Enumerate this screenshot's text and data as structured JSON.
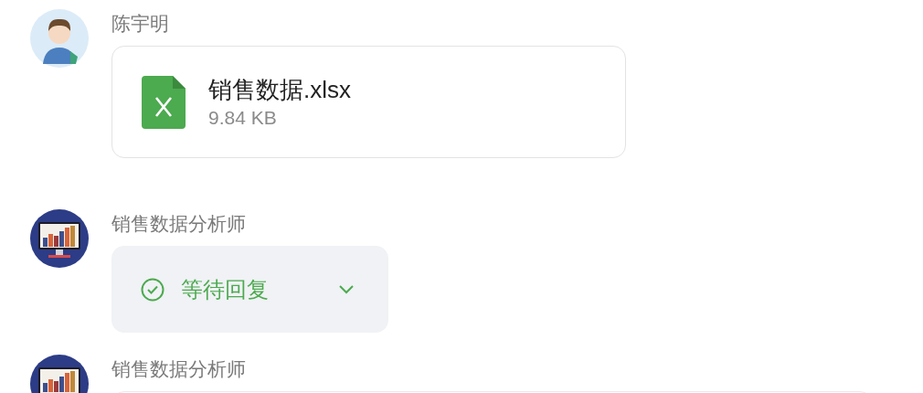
{
  "messages": [
    {
      "kind": "file",
      "avatar": {
        "kind": "person"
      },
      "sender": "陈宇明",
      "file_name": "销售数据.xlsx",
      "file_size": "9.84 KB"
    },
    {
      "kind": "status",
      "avatar": {
        "kind": "chart"
      },
      "sender": "销售数据分析师",
      "status": "等待回复",
      "expanded": false
    },
    {
      "kind": "text",
      "avatar": {
        "kind": "chart"
      },
      "sender": "销售数据分析师"
    }
  ]
}
